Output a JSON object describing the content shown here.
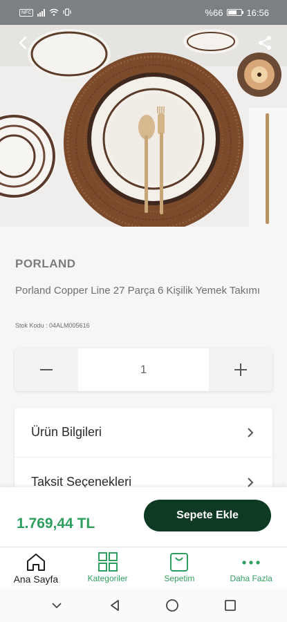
{
  "status_bar": {
    "sim_label": "NFC",
    "battery_text": "%66",
    "time": "16:56"
  },
  "product": {
    "brand": "PORLAND",
    "title": "Porland Copper Line 27 Parça 6 Kişilik Yemek Takımı",
    "stock_code": "Stok Kodu : 04ALM005616",
    "quantity": "1",
    "price": "1.769,44 TL"
  },
  "accordion": {
    "items": [
      {
        "label": "Ürün Bilgileri"
      },
      {
        "label": "Taksit Seçenekleri"
      }
    ]
  },
  "actions": {
    "add_to_cart_label": "Sepete Ekle"
  },
  "bottom_nav": {
    "items": [
      {
        "label": "Ana Sayfa",
        "icon": "home-icon"
      },
      {
        "label": "Kategoriler",
        "icon": "grid-icon"
      },
      {
        "label": "Sepetim",
        "icon": "bag-icon"
      },
      {
        "label": "Daha Fazla",
        "icon": "more-icon"
      }
    ]
  },
  "colors": {
    "accent_green": "#2e9e5e",
    "button_dark": "#0e3a23",
    "status_bar": "#7d8082"
  }
}
